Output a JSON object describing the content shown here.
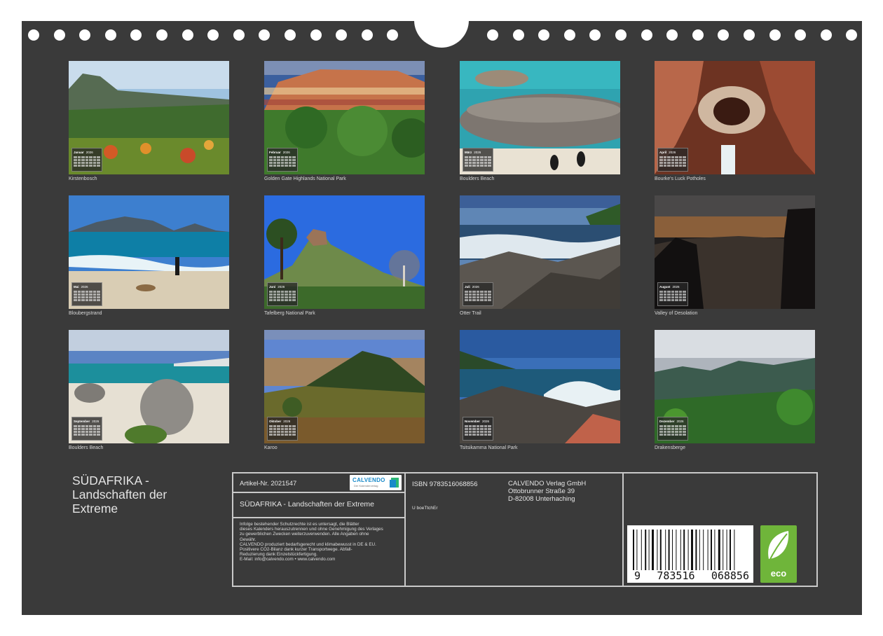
{
  "months": [
    {
      "month": "Januar",
      "year": "2026",
      "caption": "Kirstenbosch",
      "scene": "mountain-garden"
    },
    {
      "month": "Februar",
      "year": "2026",
      "caption": "Golden Gate Highlands National Park",
      "scene": "sandstone-cliff"
    },
    {
      "month": "März",
      "year": "2026",
      "caption": "Boulders Beach",
      "scene": "penguin-rocks"
    },
    {
      "month": "April",
      "year": "2026",
      "caption": "Bourke's Luck Potholes",
      "scene": "canyon-potholes"
    },
    {
      "month": "Mai",
      "year": "2026",
      "caption": "Bloubergstrand",
      "scene": "beach-wave"
    },
    {
      "month": "Juni",
      "year": "2026",
      "caption": "Tafelberg National Park",
      "scene": "lions-head"
    },
    {
      "month": "Juli",
      "year": "2026",
      "caption": "Otter Trail",
      "scene": "rocky-coast"
    },
    {
      "month": "August",
      "year": "2026",
      "caption": "Valley of Desolation",
      "scene": "sunset-valley"
    },
    {
      "month": "September",
      "year": "2026",
      "caption": "Boulders Beach",
      "scene": "boulder-beach"
    },
    {
      "month": "Oktober",
      "year": "2026",
      "caption": "Karoo",
      "scene": "karoo-hill"
    },
    {
      "month": "November",
      "year": "2026",
      "caption": "Tsitsikamma National Park",
      "scene": "surf-coast"
    },
    {
      "month": "Dezember",
      "year": "2026",
      "caption": "Drakensberge",
      "scene": "green-mountains"
    }
  ],
  "cover_title": {
    "line1": "SÜDAFRIKA -",
    "line2": "Landschaften der",
    "line3": "Extreme"
  },
  "info": {
    "article": "Artikel-Nr. 2021547",
    "title": "SÜDAFRIKA - Landschaften der Extreme",
    "legal_lines": [
      "Infolge bestehender Schutzrechte ist es untersagt, die Blätter",
      "dieses Kalenders herauszutrennen und ohne Genehmigung des Verlages",
      "zu gewerblichen Zwecken weiterzuverwenden. Alle Angaben ohne",
      "Gewähr.",
      "CALVENDO produziert bedarfsgerecht und klimabewusst in DE & EU.",
      "Positivere CO2-Bilanz dank kurzer Transportwege. Abfall-",
      "Reduzierung dank Einzelstückfertigung.",
      "E-Mail: info@calvendo.com • www.calvendo.com"
    ],
    "isbn": "ISBN 9783516068856",
    "code": "U boeTtchEr",
    "publisher": {
      "name": "CALVENDO Verlag GmbH",
      "street": "Ottobrunner Straße 39",
      "city": "D-82008 Unterhaching"
    },
    "barcode_digits": [
      "9",
      "783516",
      "068856"
    ],
    "logo_word": "CALVENDO",
    "logo_sub": "Der Kalenderverlag",
    "eco_label": "eco"
  },
  "colors": {
    "background": "#3a3a3a",
    "panel_border": "#c9c9c9",
    "eco_green": "#6fb53a",
    "logo_blue": "#1a8ac9"
  }
}
